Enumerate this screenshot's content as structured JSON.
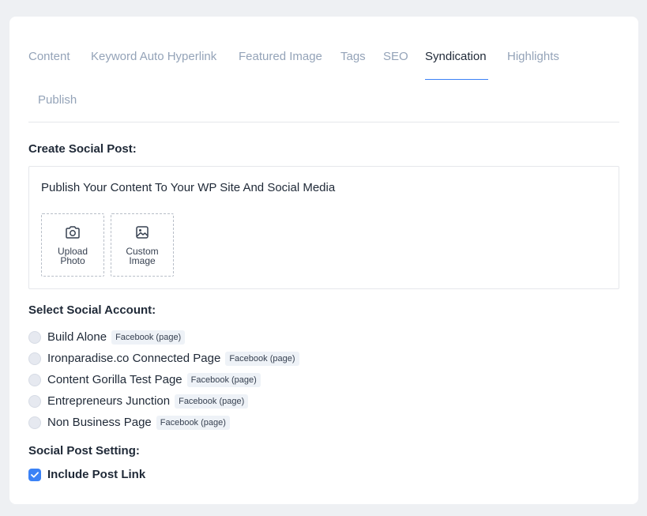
{
  "tabs": [
    {
      "label": "Content"
    },
    {
      "label": "Keyword Auto Hyperlink"
    },
    {
      "label": "Featured Image"
    },
    {
      "label": "Tags"
    },
    {
      "label": "SEO"
    },
    {
      "label": "Syndication",
      "active": true
    },
    {
      "label": "Highlights"
    },
    {
      "label": "Publish"
    }
  ],
  "create_post": {
    "title": "Create Social Post:",
    "text": "Publish Your Content To Your WP Site And Social Media",
    "upload_photo_label": "Upload Photo",
    "custom_image_label": "Custom Image"
  },
  "accounts": {
    "title": "Select Social Account:",
    "items": [
      {
        "name": "Build Alone",
        "badge": "Facebook (page)"
      },
      {
        "name": "Ironparadise.co Connected Page",
        "badge": "Facebook (page)"
      },
      {
        "name": "Content Gorilla Test Page",
        "badge": "Facebook (page)"
      },
      {
        "name": "Entrepreneurs Junction",
        "badge": "Facebook (page)"
      },
      {
        "name": "Non Business Page",
        "badge": "Facebook (page)"
      }
    ]
  },
  "settings": {
    "title": "Social Post Setting:",
    "include_post_link_label": "Include Post Link",
    "include_post_link_checked": true
  },
  "colors": {
    "accent": "#3b82f6",
    "inactive_tab": "#94a3b8",
    "text": "#1f2937"
  }
}
